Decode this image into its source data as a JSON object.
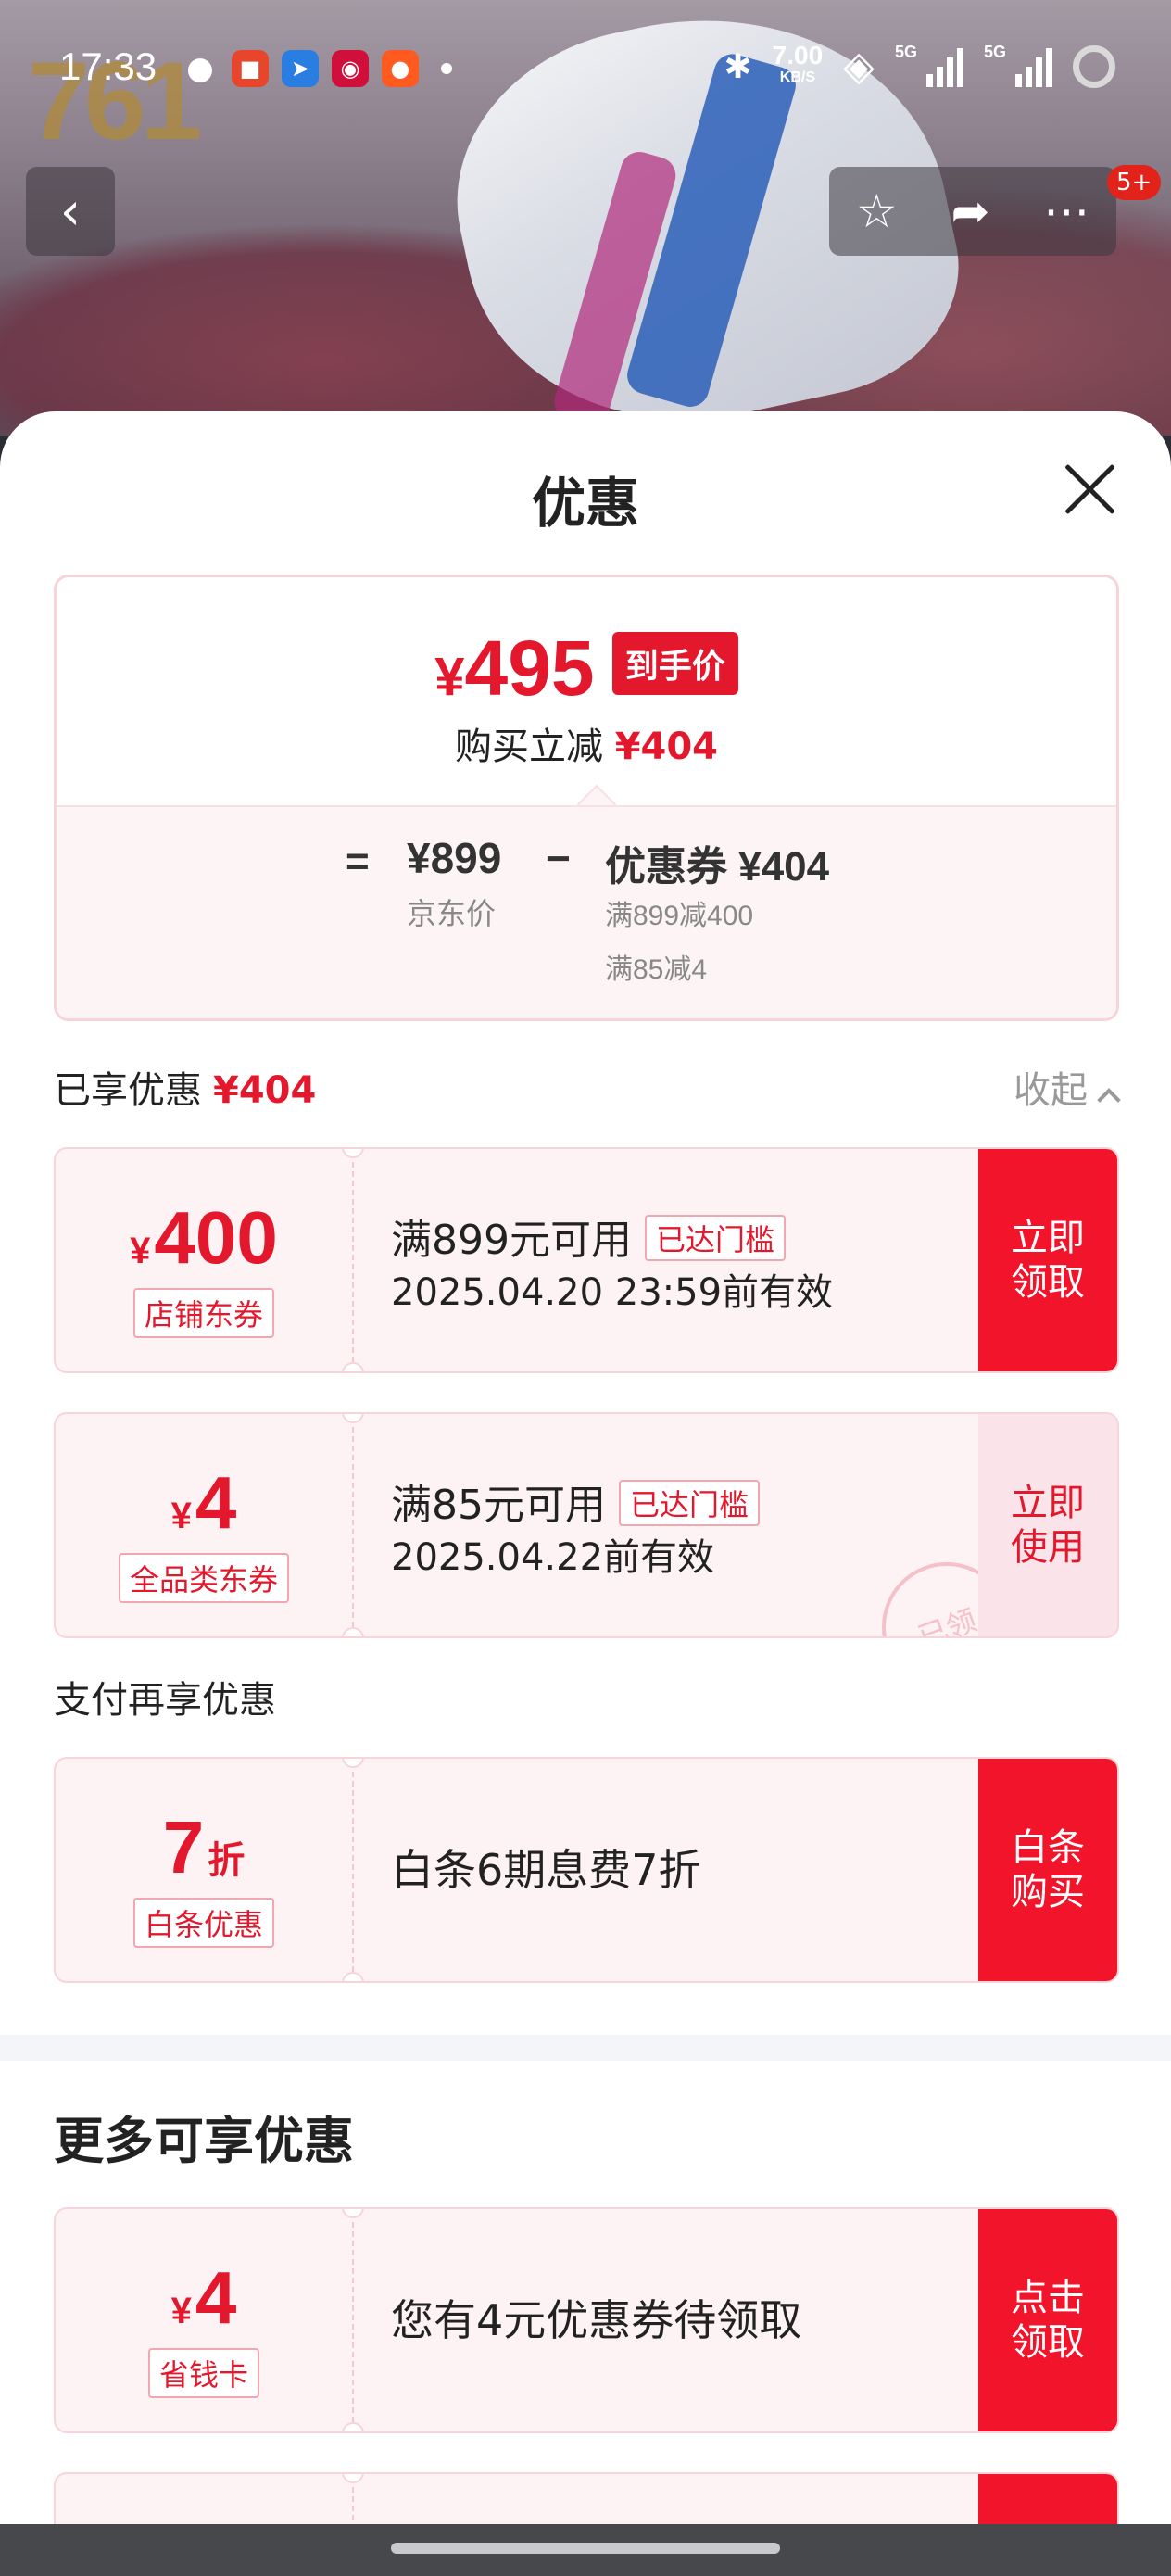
{
  "status_bar": {
    "time": "17:33",
    "net_speed": "7.00",
    "net_unit": "KB/S",
    "signal1": "5G",
    "signal2": "5G"
  },
  "hero": {
    "brand": "761",
    "badge_count": "5+"
  },
  "sheet": {
    "title": "优惠"
  },
  "summary": {
    "price_symbol": "¥",
    "price": "495",
    "price_tag": "到手价",
    "save_label": "购买立减",
    "save_value": "¥404",
    "eq": "=",
    "jd_price": "¥899",
    "jd_price_label": "京东价",
    "minus": "−",
    "coupon_total": "优惠券 ¥404",
    "rule1": "满899减400",
    "rule2": "满85减4"
  },
  "enjoyed": {
    "label": "已享优惠",
    "value": "¥404",
    "collapse": "收起"
  },
  "coupons": [
    {
      "symbol": "¥",
      "amount": "400",
      "type": "店铺东券",
      "desc": "满899元可用",
      "threshold": "已达门槛",
      "valid": "2025.04.20 23:59前有效",
      "button": "立即\n领取"
    },
    {
      "symbol": "¥",
      "amount": "4",
      "type": "全品类东券",
      "desc": "满85元可用",
      "threshold": "已达门槛",
      "valid": "2025.04.22前有效",
      "button": "立即\n使用",
      "stamp": "已领"
    }
  ],
  "pay_section": {
    "label": "支付再享优惠",
    "amount": "7",
    "unit": "折",
    "type": "白条优惠",
    "desc": "白条6期息费7折",
    "button": "白条\n购买"
  },
  "more": {
    "title": "更多可享优惠",
    "card": {
      "symbol": "¥",
      "amount": "4",
      "type": "省钱卡",
      "desc": "您有4元优惠券待领取",
      "button": "点击\n领取"
    }
  },
  "colors": {
    "accent": "#e4182c",
    "button": "#f1142b",
    "coupon_bg": "#fdf2f4"
  }
}
